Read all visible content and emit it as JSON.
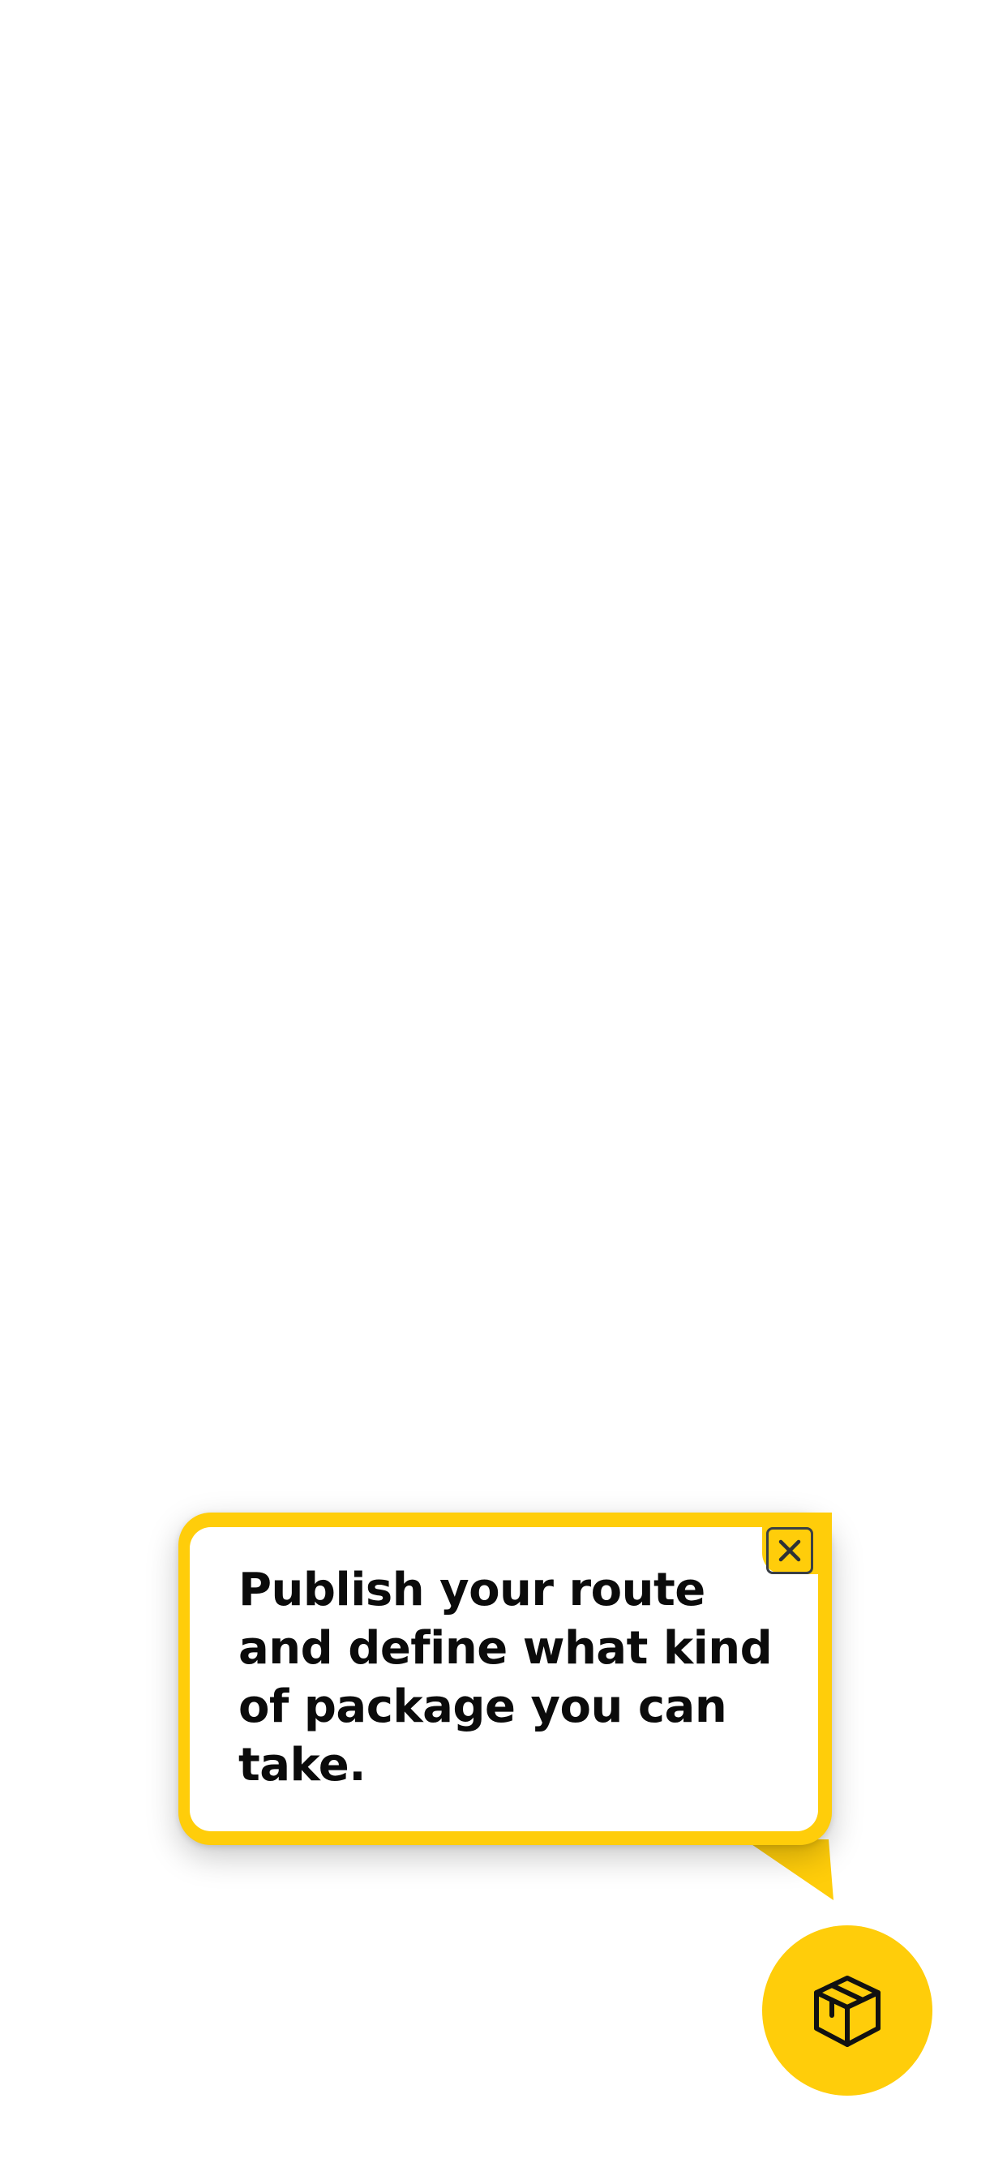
{
  "tooltip": {
    "message": "Publish your route and define what kind of package you can take.",
    "close_icon": "close-icon"
  },
  "fab": {
    "icon": "package-box-icon"
  },
  "colors": {
    "accent": "#FFCD0A",
    "text": "#0B0B0B",
    "background": "#FFFFFF"
  }
}
